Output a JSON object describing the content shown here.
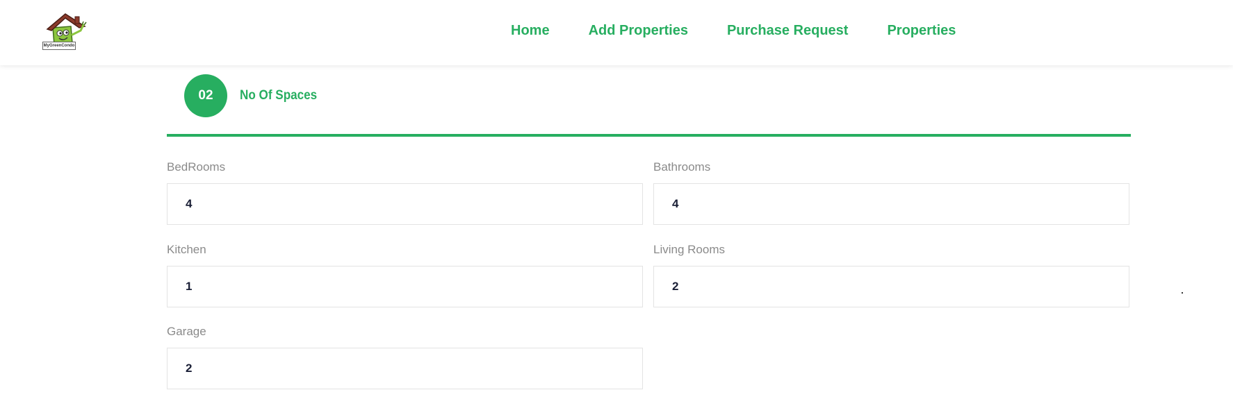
{
  "header": {
    "logo_text": "MyGreenCondo",
    "nav": {
      "home": "Home",
      "add_properties": "Add Properties",
      "purchase_request": "Purchase Request",
      "properties": "Properties"
    }
  },
  "step": {
    "number": "02",
    "title": "No Of Spaces"
  },
  "form": {
    "bedrooms": {
      "label": "BedRooms",
      "value": "4"
    },
    "bathrooms": {
      "label": "Bathrooms",
      "value": "4"
    },
    "kitchen": {
      "label": "Kitchen",
      "value": "1"
    },
    "living_rooms": {
      "label": "Living Rooms",
      "value": "2"
    },
    "garage": {
      "label": "Garage",
      "value": "2"
    }
  },
  "colors": {
    "accent": "#27ae60",
    "label": "#8a8a8a",
    "value": "#1a1f36"
  }
}
